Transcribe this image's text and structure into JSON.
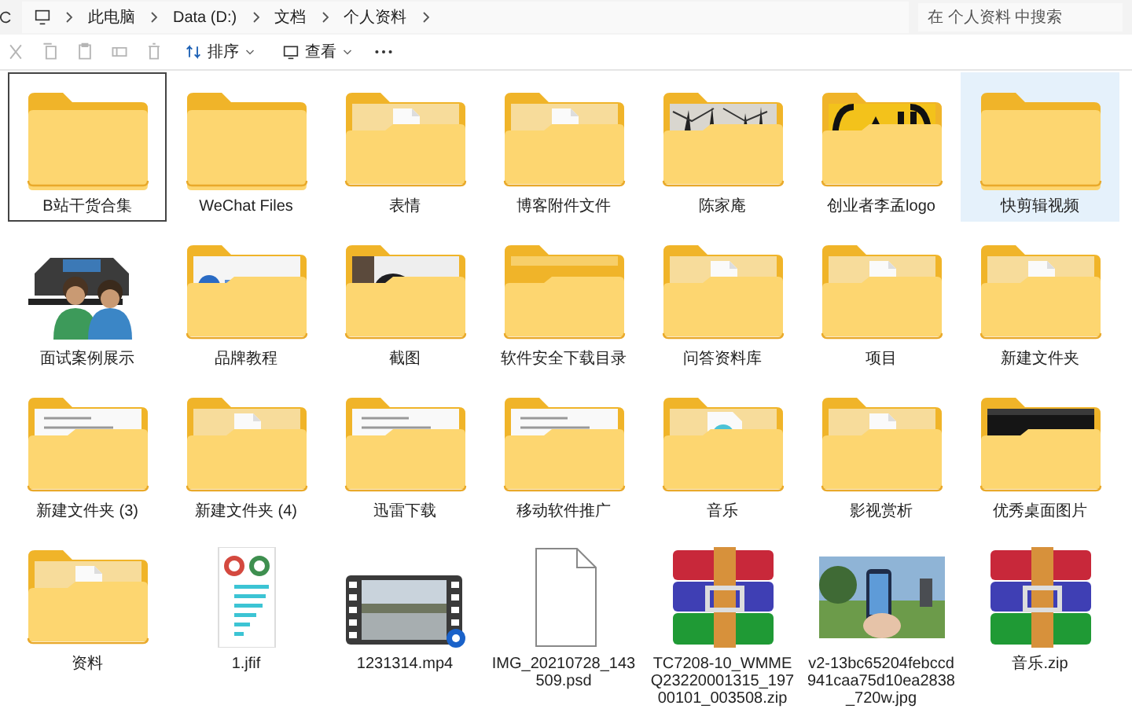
{
  "address_bar": {
    "path": [
      "此电脑",
      "Data (D:)",
      "文档",
      "个人资料"
    ]
  },
  "search": {
    "placeholder": "在 个人资料 中搜索"
  },
  "toolbar": {
    "actions": [
      {
        "kind": "cut",
        "disabled": true
      },
      {
        "kind": "copy",
        "disabled": true
      },
      {
        "kind": "paste",
        "disabled": true
      },
      {
        "kind": "rename",
        "disabled": true
      },
      {
        "kind": "delete",
        "disabled": true
      }
    ],
    "menus": [
      {
        "kind": "sort",
        "label": "排序"
      },
      {
        "kind": "view",
        "label": "查看"
      }
    ]
  },
  "items": [
    {
      "name": "B站干货合集",
      "kind": "folder",
      "selected": false,
      "focused": true
    },
    {
      "name": "WeChat Files",
      "kind": "folder",
      "selected": false,
      "focused": false
    },
    {
      "name": "表情",
      "kind": "folder-doc",
      "selected": false,
      "focused": false
    },
    {
      "name": "博客附件文件",
      "kind": "folder-doc",
      "selected": false,
      "focused": false
    },
    {
      "name": "陈家庵",
      "kind": "folder-photo",
      "selected": false,
      "focused": false
    },
    {
      "name": "创业者李孟logo",
      "kind": "folder-logo",
      "selected": false,
      "focused": false
    },
    {
      "name": "快剪辑视频",
      "kind": "folder",
      "selected": true,
      "focused": false
    },
    {
      "name": "面试案例展示",
      "kind": "users",
      "selected": false,
      "focused": false
    },
    {
      "name": "品牌教程",
      "kind": "folder-brand",
      "selected": false,
      "focused": false
    },
    {
      "name": "截图",
      "kind": "folder-screenshot",
      "selected": false,
      "focused": false
    },
    {
      "name": "软件安全下载目录",
      "kind": "folder-empty",
      "selected": false,
      "focused": false
    },
    {
      "name": "问答资料库",
      "kind": "folder-doc",
      "selected": false,
      "focused": false
    },
    {
      "name": "项目",
      "kind": "folder-doc",
      "selected": false,
      "focused": false
    },
    {
      "name": "新建文件夹",
      "kind": "folder-doc",
      "selected": false,
      "focused": false
    },
    {
      "name": "新建文件夹 (3)",
      "kind": "folder-page",
      "selected": false,
      "focused": false
    },
    {
      "name": "新建文件夹 (4)",
      "kind": "folder-doc",
      "selected": false,
      "focused": false
    },
    {
      "name": "迅雷下载",
      "kind": "folder-page",
      "selected": false,
      "focused": false
    },
    {
      "name": "移动软件推广",
      "kind": "folder-page",
      "selected": false,
      "focused": false
    },
    {
      "name": "音乐",
      "kind": "folder-media",
      "selected": false,
      "focused": false
    },
    {
      "name": "影视赏析",
      "kind": "folder-doc",
      "selected": false,
      "focused": false
    },
    {
      "name": "优秀桌面图片",
      "kind": "folder-dark",
      "selected": false,
      "focused": false
    },
    {
      "name": "资料",
      "kind": "folder-doc",
      "selected": false,
      "focused": false
    },
    {
      "name": "1.jfif",
      "kind": "infographic",
      "selected": false,
      "focused": false
    },
    {
      "name": "1231314.mp4",
      "kind": "video",
      "selected": false,
      "focused": false
    },
    {
      "name": "IMG_20210728_143509.psd",
      "kind": "file",
      "selected": false,
      "focused": false
    },
    {
      "name": "TC7208-10_WMMEQ23220001315_19700101_003508.zip",
      "kind": "archive",
      "selected": false,
      "focused": false
    },
    {
      "name": "v2-13bc65204febccd941caa75d10ea2838_720w.jpg",
      "selected": false,
      "focused": false
    },
    {
      "name": "音乐.zip",
      "kind": "archive",
      "selected": false,
      "focused": false
    }
  ]
}
